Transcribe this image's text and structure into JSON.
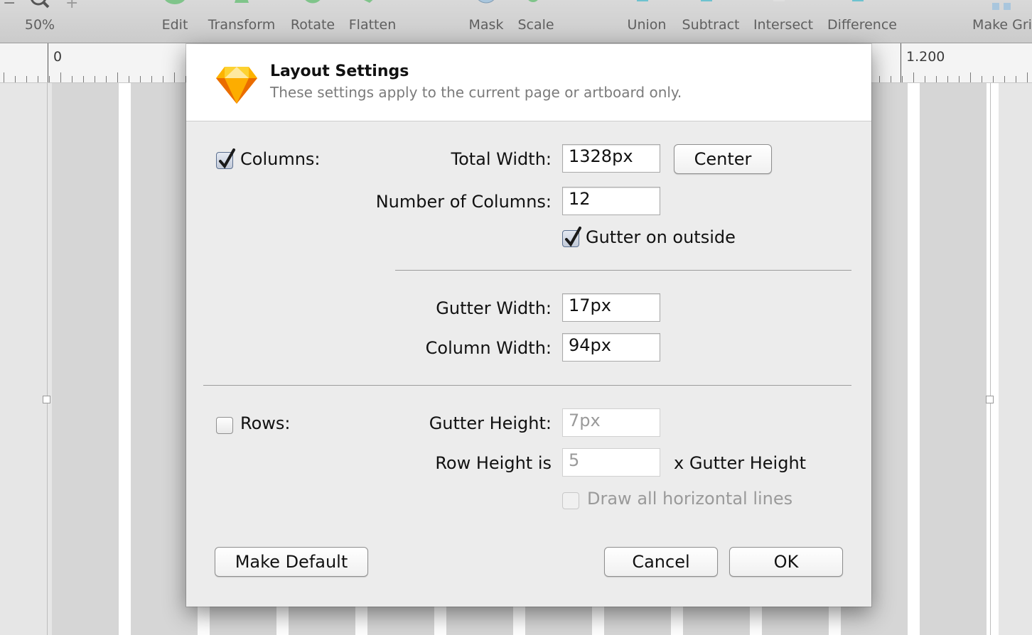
{
  "toolbar": {
    "zoom_label": "50%",
    "edit_label": "Edit",
    "transform_label": "Transform",
    "rotate_label": "Rotate",
    "flatten_label": "Flatten",
    "mask_label": "Mask",
    "scale_label": "Scale",
    "union_label": "Union",
    "subtract_label": "Subtract",
    "intersect_label": "Intersect",
    "difference_label": "Difference",
    "make_grid_label": "Make Gri"
  },
  "ruler": {
    "start_label": "0",
    "end_label": "1.200"
  },
  "dialog": {
    "title": "Layout Settings",
    "subtitle": "These settings apply to the current page or artboard only.",
    "columns": {
      "checkbox_label": "Columns:",
      "checked": true,
      "total_width_label": "Total Width:",
      "total_width_value": "1328px",
      "center_button": "Center",
      "number_of_columns_label": "Number of Columns:",
      "number_of_columns_value": "12",
      "gutter_on_outside_label": "Gutter on outside",
      "gutter_on_outside_checked": true,
      "gutter_width_label": "Gutter Width:",
      "gutter_width_value": "17px",
      "column_width_label": "Column Width:",
      "column_width_value": "94px"
    },
    "rows": {
      "checkbox_label": "Rows:",
      "checked": false,
      "gutter_height_label": "Gutter Height:",
      "gutter_height_value": "7px",
      "row_height_label": "Row Height is",
      "row_height_value": "5",
      "row_height_suffix": "x Gutter Height",
      "draw_lines_label": "Draw all horizontal lines",
      "draw_lines_checked": false
    },
    "buttons": {
      "make_default": "Make Default",
      "cancel": "Cancel",
      "ok": "OK"
    }
  }
}
